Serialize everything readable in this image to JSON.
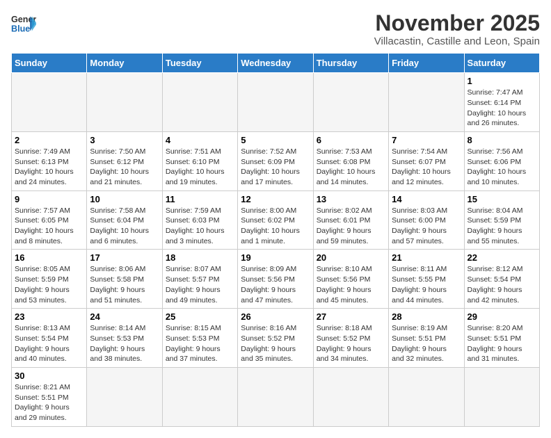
{
  "header": {
    "logo_line1": "General",
    "logo_line2": "Blue",
    "title": "November 2025",
    "subtitle": "Villacastin, Castille and Leon, Spain"
  },
  "weekdays": [
    "Sunday",
    "Monday",
    "Tuesday",
    "Wednesday",
    "Thursday",
    "Friday",
    "Saturday"
  ],
  "weeks": [
    [
      {
        "day": "",
        "info": "",
        "empty": true
      },
      {
        "day": "",
        "info": "",
        "empty": true
      },
      {
        "day": "",
        "info": "",
        "empty": true
      },
      {
        "day": "",
        "info": "",
        "empty": true
      },
      {
        "day": "",
        "info": "",
        "empty": true
      },
      {
        "day": "",
        "info": "",
        "empty": true
      },
      {
        "day": "1",
        "info": "Sunrise: 7:47 AM\nSunset: 6:14 PM\nDaylight: 10 hours\nand 26 minutes.",
        "empty": false
      }
    ],
    [
      {
        "day": "2",
        "info": "Sunrise: 7:49 AM\nSunset: 6:13 PM\nDaylight: 10 hours\nand 24 minutes.",
        "empty": false
      },
      {
        "day": "3",
        "info": "Sunrise: 7:50 AM\nSunset: 6:12 PM\nDaylight: 10 hours\nand 21 minutes.",
        "empty": false
      },
      {
        "day": "4",
        "info": "Sunrise: 7:51 AM\nSunset: 6:10 PM\nDaylight: 10 hours\nand 19 minutes.",
        "empty": false
      },
      {
        "day": "5",
        "info": "Sunrise: 7:52 AM\nSunset: 6:09 PM\nDaylight: 10 hours\nand 17 minutes.",
        "empty": false
      },
      {
        "day": "6",
        "info": "Sunrise: 7:53 AM\nSunset: 6:08 PM\nDaylight: 10 hours\nand 14 minutes.",
        "empty": false
      },
      {
        "day": "7",
        "info": "Sunrise: 7:54 AM\nSunset: 6:07 PM\nDaylight: 10 hours\nand 12 minutes.",
        "empty": false
      },
      {
        "day": "8",
        "info": "Sunrise: 7:56 AM\nSunset: 6:06 PM\nDaylight: 10 hours\nand 10 minutes.",
        "empty": false
      }
    ],
    [
      {
        "day": "9",
        "info": "Sunrise: 7:57 AM\nSunset: 6:05 PM\nDaylight: 10 hours\nand 8 minutes.",
        "empty": false
      },
      {
        "day": "10",
        "info": "Sunrise: 7:58 AM\nSunset: 6:04 PM\nDaylight: 10 hours\nand 6 minutes.",
        "empty": false
      },
      {
        "day": "11",
        "info": "Sunrise: 7:59 AM\nSunset: 6:03 PM\nDaylight: 10 hours\nand 3 minutes.",
        "empty": false
      },
      {
        "day": "12",
        "info": "Sunrise: 8:00 AM\nSunset: 6:02 PM\nDaylight: 10 hours\nand 1 minute.",
        "empty": false
      },
      {
        "day": "13",
        "info": "Sunrise: 8:02 AM\nSunset: 6:01 PM\nDaylight: 9 hours\nand 59 minutes.",
        "empty": false
      },
      {
        "day": "14",
        "info": "Sunrise: 8:03 AM\nSunset: 6:00 PM\nDaylight: 9 hours\nand 57 minutes.",
        "empty": false
      },
      {
        "day": "15",
        "info": "Sunrise: 8:04 AM\nSunset: 5:59 PM\nDaylight: 9 hours\nand 55 minutes.",
        "empty": false
      }
    ],
    [
      {
        "day": "16",
        "info": "Sunrise: 8:05 AM\nSunset: 5:59 PM\nDaylight: 9 hours\nand 53 minutes.",
        "empty": false
      },
      {
        "day": "17",
        "info": "Sunrise: 8:06 AM\nSunset: 5:58 PM\nDaylight: 9 hours\nand 51 minutes.",
        "empty": false
      },
      {
        "day": "18",
        "info": "Sunrise: 8:07 AM\nSunset: 5:57 PM\nDaylight: 9 hours\nand 49 minutes.",
        "empty": false
      },
      {
        "day": "19",
        "info": "Sunrise: 8:09 AM\nSunset: 5:56 PM\nDaylight: 9 hours\nand 47 minutes.",
        "empty": false
      },
      {
        "day": "20",
        "info": "Sunrise: 8:10 AM\nSunset: 5:56 PM\nDaylight: 9 hours\nand 45 minutes.",
        "empty": false
      },
      {
        "day": "21",
        "info": "Sunrise: 8:11 AM\nSunset: 5:55 PM\nDaylight: 9 hours\nand 44 minutes.",
        "empty": false
      },
      {
        "day": "22",
        "info": "Sunrise: 8:12 AM\nSunset: 5:54 PM\nDaylight: 9 hours\nand 42 minutes.",
        "empty": false
      }
    ],
    [
      {
        "day": "23",
        "info": "Sunrise: 8:13 AM\nSunset: 5:54 PM\nDaylight: 9 hours\nand 40 minutes.",
        "empty": false
      },
      {
        "day": "24",
        "info": "Sunrise: 8:14 AM\nSunset: 5:53 PM\nDaylight: 9 hours\nand 38 minutes.",
        "empty": false
      },
      {
        "day": "25",
        "info": "Sunrise: 8:15 AM\nSunset: 5:53 PM\nDaylight: 9 hours\nand 37 minutes.",
        "empty": false
      },
      {
        "day": "26",
        "info": "Sunrise: 8:16 AM\nSunset: 5:52 PM\nDaylight: 9 hours\nand 35 minutes.",
        "empty": false
      },
      {
        "day": "27",
        "info": "Sunrise: 8:18 AM\nSunset: 5:52 PM\nDaylight: 9 hours\nand 34 minutes.",
        "empty": false
      },
      {
        "day": "28",
        "info": "Sunrise: 8:19 AM\nSunset: 5:51 PM\nDaylight: 9 hours\nand 32 minutes.",
        "empty": false
      },
      {
        "day": "29",
        "info": "Sunrise: 8:20 AM\nSunset: 5:51 PM\nDaylight: 9 hours\nand 31 minutes.",
        "empty": false
      }
    ],
    [
      {
        "day": "30",
        "info": "Sunrise: 8:21 AM\nSunset: 5:51 PM\nDaylight: 9 hours\nand 29 minutes.",
        "empty": false
      },
      {
        "day": "",
        "info": "",
        "empty": true
      },
      {
        "day": "",
        "info": "",
        "empty": true
      },
      {
        "day": "",
        "info": "",
        "empty": true
      },
      {
        "day": "",
        "info": "",
        "empty": true
      },
      {
        "day": "",
        "info": "",
        "empty": true
      },
      {
        "day": "",
        "info": "",
        "empty": true
      }
    ]
  ]
}
